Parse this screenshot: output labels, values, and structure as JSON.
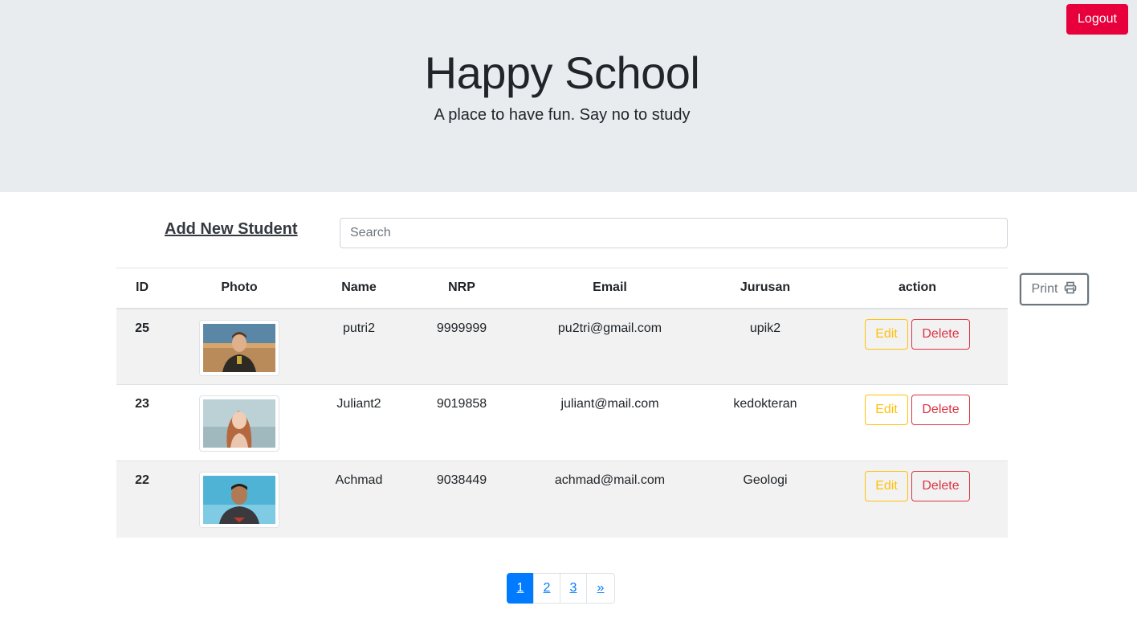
{
  "header": {
    "title": "Happy School",
    "subtitle": "A place to have fun. Say no to study",
    "logout_label": "Logout"
  },
  "toolbar": {
    "add_student_label": "Add New Student",
    "search_placeholder": "Search",
    "print_label": "Print",
    "print_icon": "printer-icon"
  },
  "table": {
    "headers": {
      "id": "ID",
      "photo": "Photo",
      "name": "Name",
      "nrp": "NRP",
      "email": "Email",
      "jurusan": "Jurusan",
      "action": "action"
    },
    "rows": [
      {
        "id": "25",
        "name": "putri2",
        "nrp": "9999999",
        "email": "pu2tri@gmail.com",
        "jurusan": "upik2",
        "edit_label": "Edit",
        "delete_label": "Delete"
      },
      {
        "id": "23",
        "name": "Juliant2",
        "nrp": "9019858",
        "email": "juliant@mail.com",
        "jurusan": "kedokteran",
        "edit_label": "Edit",
        "delete_label": "Delete"
      },
      {
        "id": "22",
        "name": "Achmad",
        "nrp": "9038449",
        "email": "achmad@mail.com",
        "jurusan": "Geologi",
        "edit_label": "Edit",
        "delete_label": "Delete"
      }
    ]
  },
  "pagination": {
    "pages": [
      "1",
      "2",
      "3"
    ],
    "active_page": "1",
    "next_label": "»"
  },
  "colors": {
    "logout": "#e8003d",
    "primary": "#007bff",
    "warning": "#ffc107",
    "danger": "#dc3545",
    "jumbotron": "#e9ecef"
  }
}
